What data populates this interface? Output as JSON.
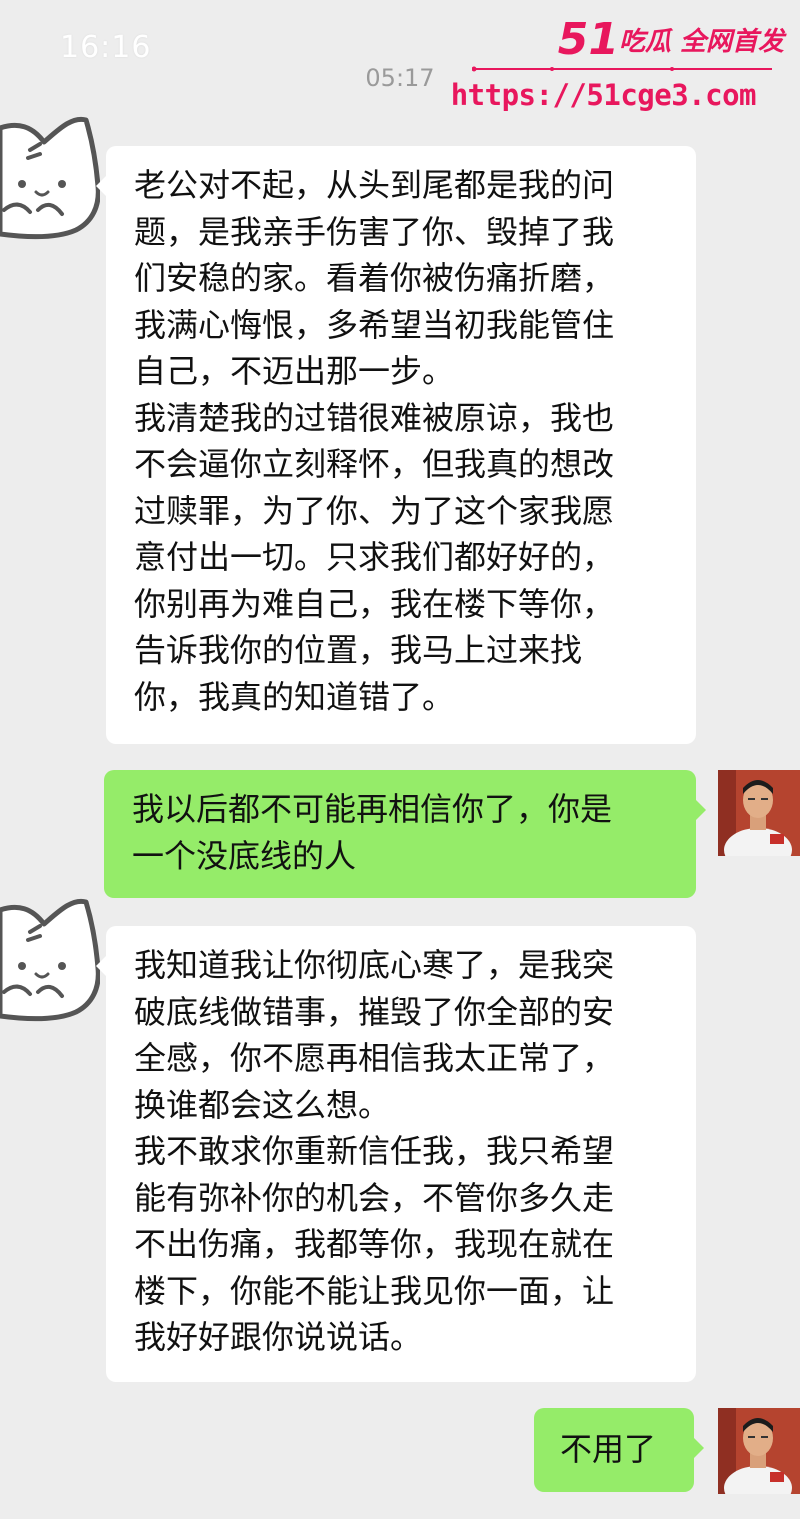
{
  "status_bar": {
    "time": "16:16"
  },
  "chat": {
    "timestamp": "05:17",
    "messages": [
      {
        "sender": "contact",
        "lines": [
          "老公对不起，从头到尾都是我的问",
          "题，是我亲手伤害了你、毁掉了我",
          "们安稳的家。看着你被伤痛折磨，",
          "我满心悔恨，多希望当初我能管住",
          "自己，不迈出那一步。",
          "我清楚我的过错很难被原谅，我也",
          "不会逼你立刻释怀，但我真的想改",
          "过赎罪，为了你、为了这个家我愿",
          "意付出一切。只求我们都好好的，",
          "你别再为难自己，我在楼下等你，",
          "告诉我你的位置，我马上过来找",
          "你，我真的知道错了。"
        ]
      },
      {
        "sender": "self",
        "lines": [
          "我以后都不可能再相信你了，你是",
          "一个没底线的人"
        ]
      },
      {
        "sender": "contact",
        "lines": [
          "我知道我让你彻底心寒了，是我突",
          "破底线做错事，摧毁了你全部的安",
          "全感，你不愿再相信我太正常了，",
          "换谁都会这么想。",
          "我不敢求你重新信任我，我只希望",
          "能有弥补你的机会，不管你多久走",
          "不出伤痛，我都等你，我现在就在",
          "楼下，你能不能让我见你一面，让",
          "我好好跟你说说话。"
        ]
      },
      {
        "sender": "self",
        "lines": [
          "不用了"
        ]
      }
    ]
  },
  "watermark": {
    "logo_number": "51",
    "logo_text": "吃瓜 全网首发",
    "url": "https://51cge3.com"
  },
  "colors": {
    "background": "#ededed",
    "incoming_bubble": "#ffffff",
    "outgoing_bubble": "#95ec69",
    "watermark": "#e8175d"
  },
  "icons": {
    "contact_avatar": "cat-avatar-icon",
    "self_avatar": "user-photo-avatar"
  }
}
